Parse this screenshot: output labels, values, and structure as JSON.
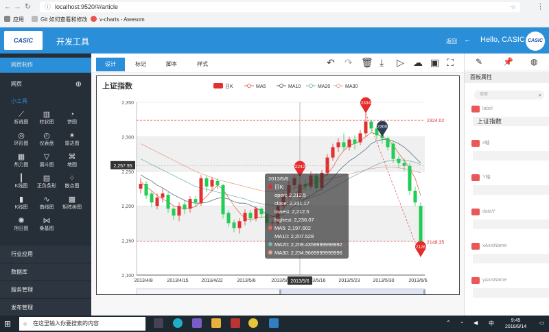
{
  "browser": {
    "url": "localhost:9520/#/article",
    "bookmarks": [
      "应用",
      "Git 如何查看和修改",
      "v-charts - Awesom"
    ]
  },
  "header": {
    "logo_text": "CASIC",
    "title": "开发工具",
    "back_label": "返回",
    "greeting": "Hello, CASIC"
  },
  "sidebar": {
    "page_design": "网页制作",
    "web_page": "网页",
    "small_tools": "小工具",
    "tools": [
      {
        "label": "折线图",
        "icon": "line-chart-icon"
      },
      {
        "label": "柱状图",
        "icon": "bar-chart-icon"
      },
      {
        "label": "饼图",
        "icon": "pie-chart-icon"
      },
      {
        "label": "环形图",
        "icon": "ring-chart-icon"
      },
      {
        "label": "仪表盘",
        "icon": "gauge-icon"
      },
      {
        "label": "雷达图",
        "icon": "radar-icon"
      },
      {
        "label": "热力图",
        "icon": "heatmap-icon"
      },
      {
        "label": "漏斗图",
        "icon": "funnel-icon"
      },
      {
        "label": "地图",
        "icon": "map-icon"
      },
      {
        "label": "K线图",
        "icon": "candlestick-icon"
      },
      {
        "label": "正负条形",
        "icon": "pos-neg-bar-icon"
      },
      {
        "label": "散点图",
        "icon": "scatter-icon"
      },
      {
        "label": "K线图",
        "icon": "candlestick-icon-2"
      },
      {
        "label": "曲线图",
        "icon": "curve-icon"
      },
      {
        "label": "矩阵树图",
        "icon": "treemap-icon"
      },
      {
        "label": "旭日图",
        "icon": "sunburst-icon"
      },
      {
        "label": "桑基图",
        "icon": "sankey-icon"
      }
    ],
    "industry": "行业应用",
    "database": "数据库",
    "service": "服务管理",
    "publish": "发布管理"
  },
  "tabs": [
    "设计",
    "标记",
    "脚本",
    "样式"
  ],
  "panel": {
    "title": "面板属性",
    "search_placeholder": "搜索",
    "props": [
      {
        "name": "label",
        "value": "上证指数"
      },
      {
        "name": "x轴",
        "value": ""
      },
      {
        "name": "Y轴",
        "value": ""
      },
      {
        "name": "dataV",
        "value": ""
      },
      {
        "name": "xAxisName",
        "value": ""
      },
      {
        "name": "yAxisName",
        "value": ""
      }
    ]
  },
  "taskbar": {
    "search_placeholder": "在这里输入你要搜索的内容",
    "time": "9:45",
    "date": "2018/9/14",
    "lang": "中"
  },
  "chart_data": {
    "type": "candlestick",
    "title": "上证指数",
    "legend": [
      "日K",
      "MA5",
      "MA10",
      "MA20",
      "MA30"
    ],
    "legend_position": "top-center",
    "colors": {
      "up": "#e03030",
      "down": "#22cc55",
      "MA5": "#e06a55",
      "MA10": "#5b6e7d",
      "MA20": "#7fb3b0",
      "MA30": "#e8a090"
    },
    "x_ticks": [
      "2013/4/8",
      "2013/4/15",
      "2013/4/22",
      "2013/5/6",
      "2013/5/9",
      "2013/5/16",
      "2013/5/23",
      "2013/5/30",
      "2013/6/6"
    ],
    "ylim": [
      2100,
      2350
    ],
    "y_ticks": [
      2100,
      2150,
      2200,
      2250,
      2300,
      2350
    ],
    "candles": [
      [
        2225,
        2232,
        2218,
        2240
      ],
      [
        2232,
        2215,
        2210,
        2236
      ],
      [
        2218,
        2205,
        2198,
        2222
      ],
      [
        2200,
        2212,
        2195,
        2218
      ],
      [
        2212,
        2218,
        2205,
        2225
      ],
      [
        2216,
        2196,
        2190,
        2220
      ],
      [
        2196,
        2186,
        2180,
        2198
      ],
      [
        2186,
        2200,
        2178,
        2205
      ],
      [
        2202,
        2195,
        2188,
        2208
      ],
      [
        2196,
        2210,
        2190,
        2214
      ],
      [
        2210,
        2205,
        2198,
        2215
      ],
      [
        2204,
        2240,
        2200,
        2245
      ],
      [
        2240,
        2228,
        2220,
        2244
      ],
      [
        2228,
        2238,
        2222,
        2242
      ],
      [
        2236,
        2230,
        2224,
        2240
      ],
      [
        2230,
        2188,
        2182,
        2232
      ],
      [
        2190,
        2175,
        2170,
        2194
      ],
      [
        2176,
        2168,
        2162,
        2180
      ],
      [
        2168,
        2178,
        2160,
        2182
      ],
      [
        2178,
        2190,
        2172,
        2195
      ],
      [
        2190,
        2182,
        2176,
        2194
      ],
      [
        2182,
        2196,
        2178,
        2200
      ],
      [
        2196,
        2188,
        2182,
        2198
      ],
      [
        2188,
        2175,
        2168,
        2190
      ],
      [
        2176,
        2176,
        2165,
        2180
      ],
      [
        2175,
        2200,
        2170,
        2204
      ],
      [
        2200,
        2215,
        2195,
        2220
      ],
      [
        2215,
        2230,
        2210,
        2236
      ],
      [
        2230,
        2240,
        2226,
        2245
      ],
      [
        2212,
        2231,
        2212,
        2236
      ],
      [
        2232,
        2228,
        2222,
        2238
      ],
      [
        2228,
        2244,
        2224,
        2250
      ],
      [
        2244,
        2226,
        2220,
        2248
      ],
      [
        2226,
        2248,
        2222,
        2252
      ],
      [
        2248,
        2270,
        2244,
        2275
      ],
      [
        2270,
        2285,
        2265,
        2290
      ],
      [
        2285,
        2292,
        2278,
        2298
      ],
      [
        2292,
        2285,
        2280,
        2305
      ],
      [
        2285,
        2296,
        2280,
        2300
      ],
      [
        2296,
        2290,
        2282,
        2302
      ],
      [
        2292,
        2305,
        2288,
        2310
      ],
      [
        2305,
        2322,
        2300,
        2334
      ],
      [
        2322,
        2312,
        2305,
        2325
      ],
      [
        2312,
        2302,
        2296,
        2316
      ],
      [
        2302,
        2298,
        2290,
        2308
      ],
      [
        2298,
        2285,
        2280,
        2300
      ],
      [
        2290,
        2268,
        2262,
        2294
      ],
      [
        2268,
        2262,
        2255,
        2272
      ],
      [
        2262,
        2258,
        2250,
        2268
      ],
      [
        2258,
        2222,
        2216,
        2262
      ],
      [
        2222,
        2205,
        2200,
        2228
      ],
      [
        2200,
        2135,
        2126,
        2205
      ]
    ],
    "ma5": [
      2235,
      2228,
      2222,
      2215,
      2210,
      2206,
      2200,
      2198,
      2196,
      2197,
      2199,
      2206,
      2214,
      2222,
      2230,
      2224,
      2212,
      2200,
      2190,
      2182,
      2180,
      2182,
      2184,
      2184,
      2184,
      2188,
      2196,
      2206,
      2218,
      2222,
      2228,
      2236,
      2238,
      2240,
      2246,
      2256,
      2270,
      2280,
      2288,
      2290,
      2294,
      2300,
      2306,
      2304,
      2300,
      2296,
      2288,
      2276,
      2266,
      2254,
      2240,
      2215
    ],
    "ma10": [
      2245,
      2240,
      2236,
      2230,
      2226,
      2221,
      2216,
      2212,
      2208,
      2205,
      2204,
      2204,
      2205,
      2208,
      2211,
      2212,
      2210,
      2206,
      2204,
      2204,
      2201,
      2197,
      2193,
      2188,
      2185,
      2185,
      2188,
      2193,
      2200,
      2205,
      2210,
      2215,
      2220,
      2225,
      2232,
      2240,
      2250,
      2258,
      2265,
      2270,
      2276,
      2282,
      2290,
      2294,
      2296,
      2296,
      2294,
      2290,
      2285,
      2278,
      2270,
      2262
    ],
    "ma20": [
      2268,
      2264,
      2260,
      2256,
      2252,
      2248,
      2244,
      2240,
      2236,
      2232,
      2228,
      2226,
      2224,
      2222,
      2220,
      2218,
      2216,
      2214,
      2212,
      2210,
      2207,
      2205,
      2203,
      2202,
      2201,
      2201,
      2202,
      2204,
      2206,
      2209,
      2210,
      2212,
      2215,
      2218,
      2222,
      2226,
      2231,
      2235,
      2240,
      2244,
      2248,
      2252,
      2256,
      2260,
      2263,
      2265,
      2266,
      2267,
      2266,
      2265,
      2263,
      2260
    ],
    "ma30": [
      2290,
      2286,
      2282,
      2278,
      2274,
      2270,
      2266,
      2262,
      2258,
      2254,
      2250,
      2247,
      2244,
      2241,
      2238,
      2236,
      2234,
      2232,
      2230,
      2228,
      2226,
      2224,
      2222,
      2221,
      2221,
      2221,
      2222,
      2224,
      2226,
      2228,
      2230,
      2232,
      2234,
      2236,
      2238,
      2240,
      2242,
      2244,
      2246,
      2248,
      2250,
      2252,
      2254,
      2255,
      2256,
      2256,
      2256,
      2255,
      2254,
      2252,
      2250,
      2248
    ],
    "markpoints": [
      {
        "label": "2334",
        "value": 2334,
        "index": 41
      },
      {
        "label": "2300",
        "value": 2300,
        "index": 44
      },
      {
        "label": "2242",
        "value": 2242,
        "index": 29
      },
      {
        "label": "2126",
        "value": 2126,
        "index": 51
      }
    ],
    "marklines": [
      {
        "label": "2324.02",
        "value": 2324.02
      },
      {
        "label": "2148.35",
        "value": 2148.35
      }
    ],
    "cursor_y_label": "2,257.95",
    "tooltip": {
      "date": "2013/5/6",
      "series": "日K:",
      "lines": [
        "open: 2,212.5",
        "close: 2,231.17",
        "lowest: 2,212.5",
        "highest: 2,236.07",
        "MA5: 2,197.602",
        "MA10: 2,207.528",
        "MA20: 2,209.4359999999992",
        "MA30: 2,234.9669999999996"
      ]
    }
  }
}
